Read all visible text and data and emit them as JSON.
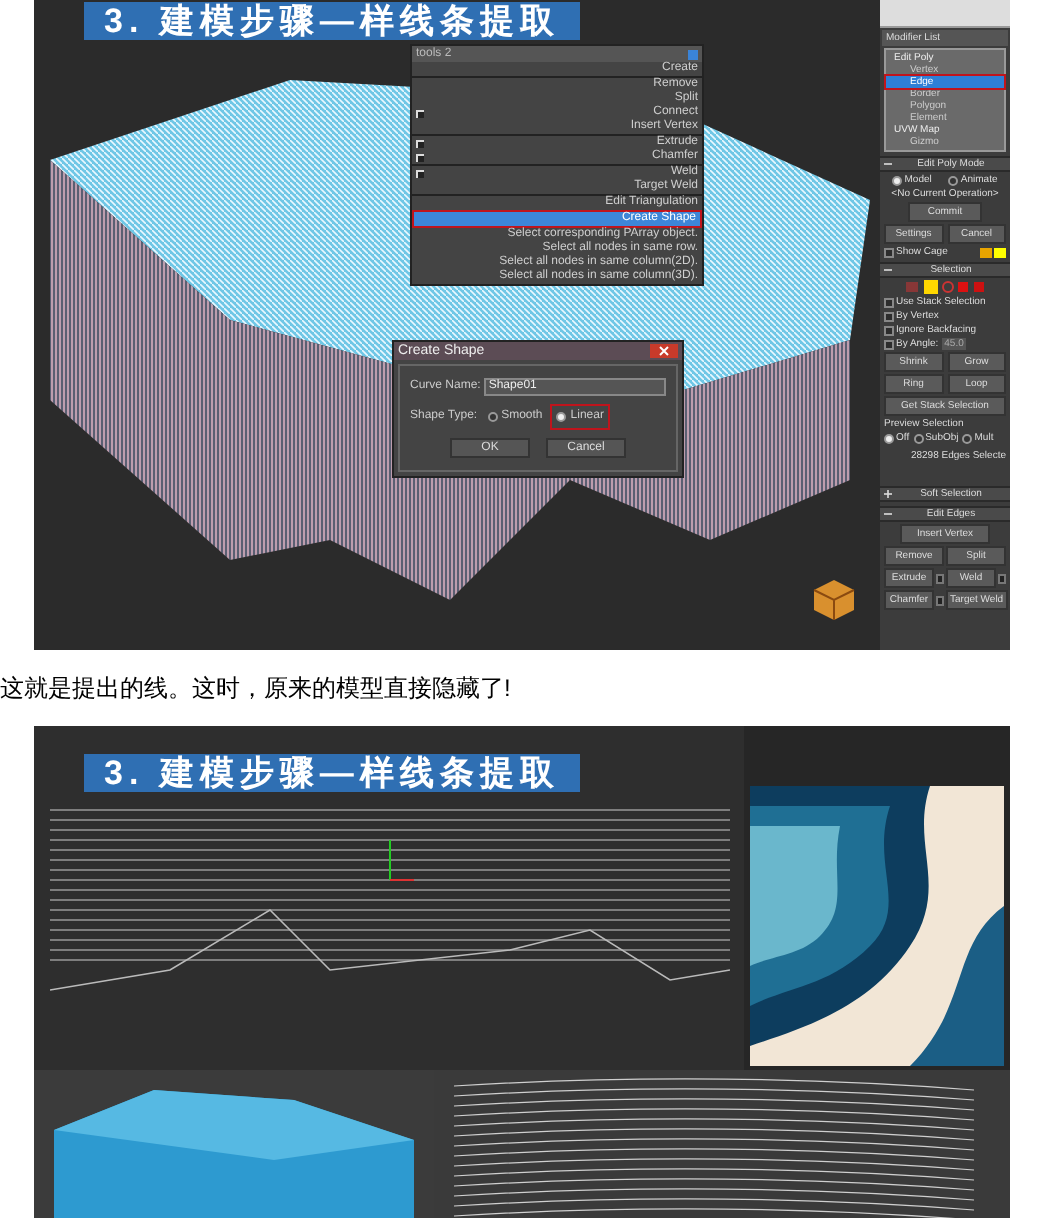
{
  "screenshot_1": {
    "banner": "3. 建模步骤—样线条提取",
    "quad_menu": {
      "title": "tools 2",
      "groups": [
        [
          {
            "label": "Create",
            "selected": false,
            "settings": false
          }
        ],
        [
          {
            "label": "Remove",
            "selected": false,
            "settings": false
          },
          {
            "label": "Split",
            "selected": false,
            "settings": false
          },
          {
            "label": "Connect",
            "selected": false,
            "settings": true
          },
          {
            "label": "Insert Vertex",
            "selected": false,
            "settings": false
          }
        ],
        [
          {
            "label": "Extrude",
            "selected": false,
            "settings": true
          },
          {
            "label": "Chamfer",
            "selected": false,
            "settings": true
          }
        ],
        [
          {
            "label": "Weld",
            "selected": false,
            "settings": true
          },
          {
            "label": "Target Weld",
            "selected": false,
            "settings": false
          }
        ],
        [
          {
            "label": "Edit Triangulation",
            "selected": false,
            "settings": false
          },
          {
            "label": "Create Shape",
            "selected": true,
            "settings": false
          },
          {
            "label": "Select corresponding PArray object.",
            "selected": false,
            "settings": false
          },
          {
            "label": "Select all nodes in same row.",
            "selected": false,
            "settings": false
          },
          {
            "label": "Select all nodes in same column(2D).",
            "selected": false,
            "settings": false
          },
          {
            "label": "Select all nodes in same column(3D).",
            "selected": false,
            "settings": false
          }
        ]
      ]
    },
    "dialog": {
      "title": "Create Shape",
      "curve_name_label": "Curve Name:",
      "curve_name": "Shape01",
      "shape_type_label": "Shape Type:",
      "options": [
        {
          "label": "Smooth",
          "selected": false
        },
        {
          "label": "Linear",
          "selected": true
        }
      ],
      "buttons": [
        "OK",
        "Cancel"
      ]
    },
    "command_panel": {
      "modifier_list": "Modifier List",
      "stack": [
        {
          "label": "Edit Poly",
          "children": [
            {
              "label": "Vertex",
              "selected": false
            },
            {
              "label": "Edge",
              "selected": true
            },
            {
              "label": "Border",
              "selected": false
            },
            {
              "label": "Polygon",
              "selected": false
            },
            {
              "label": "Element",
              "selected": false
            }
          ]
        },
        {
          "label": "UVW Map",
          "children": [
            {
              "label": "Gizmo",
              "selected": false
            }
          ]
        }
      ],
      "edit_poly_mode": {
        "title": "Edit Poly Mode",
        "expanded": true,
        "modes": [
          {
            "label": "Model",
            "selected": true
          },
          {
            "label": "Animate",
            "selected": false
          }
        ],
        "operation": "<No Current Operation>",
        "commit": "Commit",
        "settings": "Settings",
        "cancel": "Cancel",
        "show_cage": {
          "label": "Show Cage",
          "checked": false
        }
      },
      "selection": {
        "title": "Selection",
        "expanded": true,
        "checks": [
          {
            "label": "Use Stack Selection",
            "checked": false
          },
          {
            "label": "By Vertex",
            "checked": false
          },
          {
            "label": "Ignore Backfacing",
            "checked": false
          },
          {
            "label": "By Angle:",
            "checked": false
          }
        ],
        "angle": "45.0",
        "shrink": "Shrink",
        "grow": "Grow",
        "ring": "Ring",
        "loop": "Loop",
        "get_stack": "Get Stack Selection",
        "preview_label": "Preview Selection",
        "preview": [
          {
            "label": "Off",
            "selected": true
          },
          {
            "label": "SubObj",
            "selected": false
          },
          {
            "label": "Mult",
            "selected": false
          }
        ],
        "status": "28298 Edges Selecte"
      },
      "soft_selection": {
        "title": "Soft Selection",
        "expanded": false
      },
      "edit_edges": {
        "title": "Edit Edges",
        "expanded": true,
        "insert_vertex": "Insert Vertex",
        "buttons": [
          {
            "label": "Remove",
            "settings": false
          },
          {
            "label": "Split",
            "settings": false
          },
          {
            "label": "Extrude",
            "settings": true
          },
          {
            "label": "Weld",
            "settings": true
          },
          {
            "label": "Chamfer",
            "settings": true
          },
          {
            "label": "Target Weld",
            "settings": false
          }
        ]
      }
    }
  },
  "caption": "这就是提出的线。这时，原来的模型直接隐藏了!",
  "screenshot_2": {
    "banner": "3. 建模步骤—样线条提取"
  }
}
